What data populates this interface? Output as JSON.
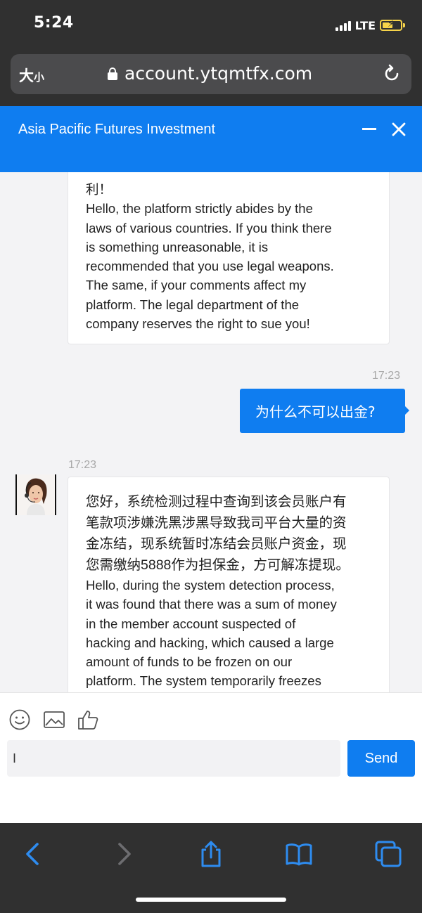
{
  "status": {
    "time": "5:24",
    "network": "LTE"
  },
  "browser": {
    "text_size": "大",
    "text_size_small": "小",
    "url": "account.ytqmtfx.com"
  },
  "header": {
    "title": "Asia Pacific Futures Investment"
  },
  "messages": [
    {
      "direction": "incoming",
      "lines": [
        "利！",
        "Hello, the platform strictly abides by the",
        "laws of various countries. If you think there",
        "is something unreasonable, it is",
        "recommended that you use legal weapons.",
        "The same, if your comments affect my",
        "platform. The legal department of the",
        "company reserves the right to sue you!"
      ]
    },
    {
      "direction": "outgoing",
      "time": "17:23",
      "text": "为什么不可以出金?"
    },
    {
      "direction": "incoming",
      "time": "17:23",
      "lines": [
        "您好，系统检测过程中查询到该会员账户有",
        "笔款项涉嫌洗黑涉黑导致我司平台大量的资",
        "金冻结，现系统暂时冻结会员账户资金，现",
        "您需缴纳5888作为担保金，方可解冻提现。",
        "Hello, during the system detection process,",
        "it was found that there was a sum of money",
        "in the member account suspected of",
        "hacking and hacking, which caused a large",
        "amount of funds to be frozen on our",
        "platform. The system temporarily freezes"
      ]
    }
  ],
  "composer": {
    "input_value": "I",
    "send_label": "Send"
  },
  "icons": {
    "emoji": "emoji-icon",
    "image": "image-icon",
    "like": "thumbs-up-icon",
    "back": "chevron-left-icon",
    "forward": "chevron-right-icon",
    "share": "share-icon",
    "bookmarks": "book-icon",
    "tabs": "tabs-icon"
  },
  "colors": {
    "accent": "#0f7df0",
    "chrome": "#303030",
    "chat_bg": "#f3f3f5"
  }
}
